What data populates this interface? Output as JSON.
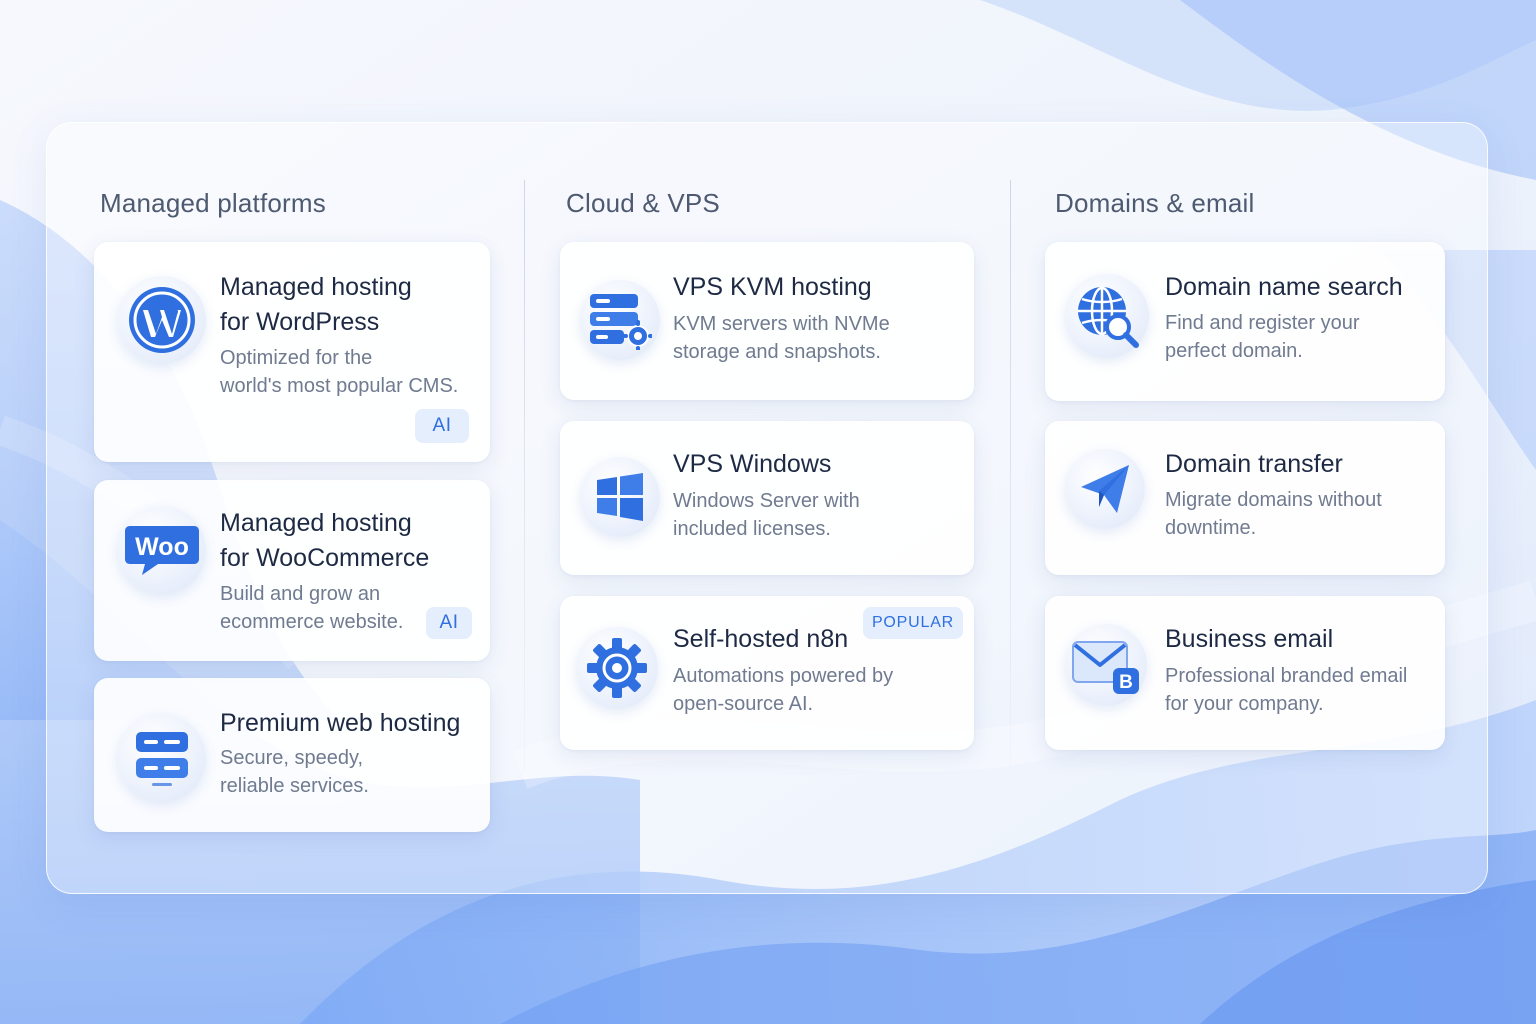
{
  "colors": {
    "accent": "#2f6fdf",
    "title": "#1e2a44",
    "desc": "#707b90",
    "heading": "#4d5a70",
    "badge_bg": "#e4eefd"
  },
  "columns": [
    {
      "heading": "Managed platforms",
      "cards": [
        {
          "title": "Managed hosting\nfor WordPress",
          "desc": "Optimized for the\nworld's most popular CMS.",
          "badge": "AI",
          "icon": "wordpress-icon"
        },
        {
          "title": "Managed hosting\nfor WooCommerce",
          "desc": "Build and grow an\necommerce website.",
          "badge": "AI",
          "icon": "woocommerce-icon"
        },
        {
          "title": "Premium web hosting",
          "desc": "Secure, speedy,\nreliable services.",
          "icon": "server-stack-icon"
        }
      ]
    },
    {
      "heading": "Cloud & VPS",
      "cards": [
        {
          "title": "VPS KVM hosting",
          "desc": "KVM servers with NVMe\nstorage and snapshots.",
          "icon": "server-gear-icon"
        },
        {
          "title": "VPS Windows",
          "desc": "Windows Server with\nincluded licenses.",
          "icon": "windows-icon"
        },
        {
          "title": "Self-hosted n8n",
          "desc": "Automations powered by\nopen-source AI.",
          "badge": "POPULAR",
          "icon": "gear-icon"
        }
      ]
    },
    {
      "heading": "Domains & email",
      "cards": [
        {
          "title": "Domain name search",
          "desc": "Find and register your\nperfect domain.",
          "icon": "globe-search-icon"
        },
        {
          "title": "Domain transfer",
          "desc": "Migrate domains without\ndowntime.",
          "icon": "paper-plane-icon"
        },
        {
          "title": "Business email",
          "desc": "Professional branded email\nfor your company.",
          "icon": "envelope-icon"
        }
      ]
    }
  ]
}
